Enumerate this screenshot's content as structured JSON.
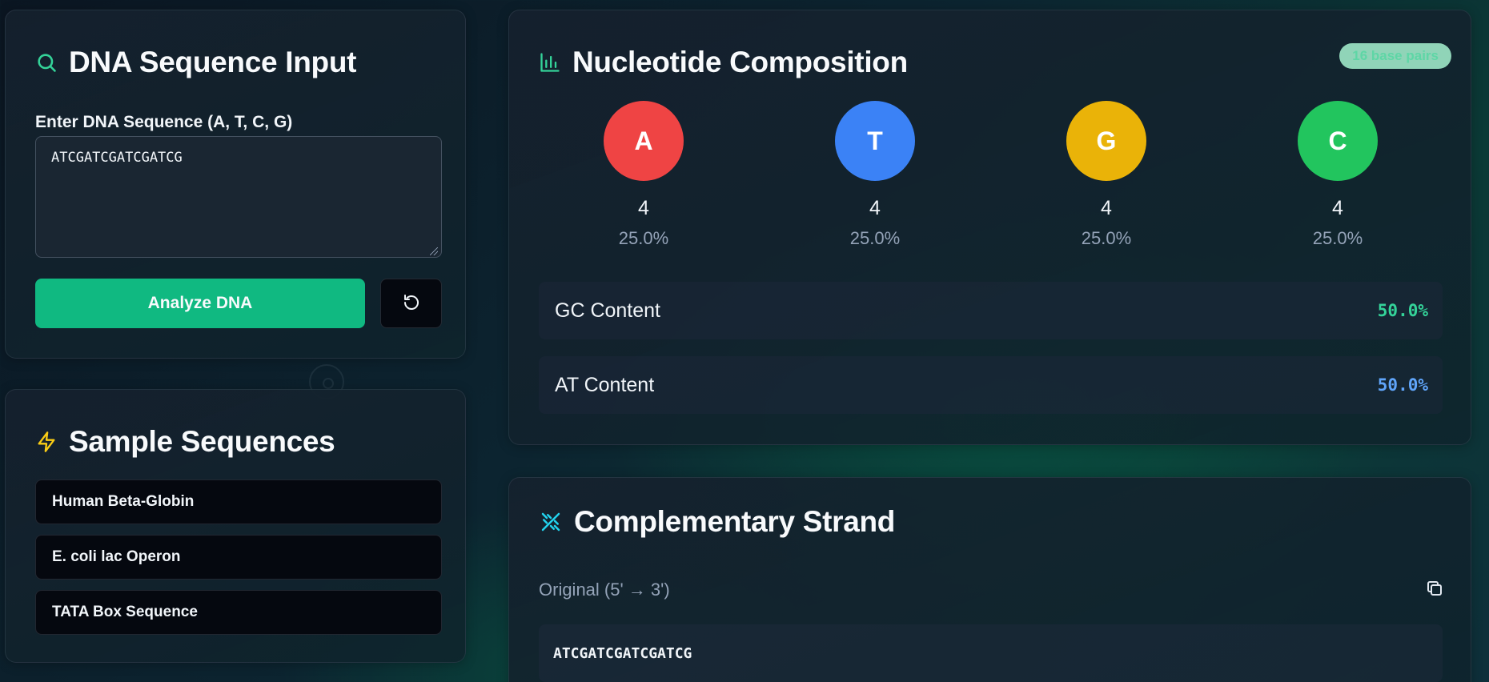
{
  "input_card": {
    "title": "DNA Sequence Input",
    "field_label": "Enter DNA Sequence (A, T, C, G)",
    "sequence_value": "ATCGATCGATCGATCG",
    "analyze_label": "Analyze DNA",
    "reset_icon": "reset-icon"
  },
  "samples_card": {
    "title": "Sample Sequences",
    "items": [
      {
        "label": "Human Beta-Globin"
      },
      {
        "label": "E. coli lac Operon"
      },
      {
        "label": "TATA Box Sequence"
      }
    ]
  },
  "composition_card": {
    "title": "Nucleotide Composition",
    "badge": "16 base pairs",
    "nucleotides": [
      {
        "base": "A",
        "count": "4",
        "percent": "25.0%",
        "color": "#ef4444"
      },
      {
        "base": "T",
        "count": "4",
        "percent": "25.0%",
        "color": "#3b82f6"
      },
      {
        "base": "G",
        "count": "4",
        "percent": "25.0%",
        "color": "#eab308"
      },
      {
        "base": "C",
        "count": "4",
        "percent": "25.0%",
        "color": "#22c55e"
      }
    ],
    "gc": {
      "label": "GC Content",
      "value": "50.0%",
      "color": "#34d399"
    },
    "at": {
      "label": "AT Content",
      "value": "50.0%",
      "color": "#60a5fa"
    }
  },
  "complement_card": {
    "title": "Complementary Strand",
    "original_label": "Original (5' → 3')",
    "original_sequence": "ATCGATCGATCGATCG"
  },
  "colors": {
    "accent_green": "#10b981",
    "title_icon_search": "#34d399",
    "title_icon_bolt": "#facc15",
    "title_icon_chart": "#34d399",
    "title_icon_dna": "#22d3ee"
  }
}
